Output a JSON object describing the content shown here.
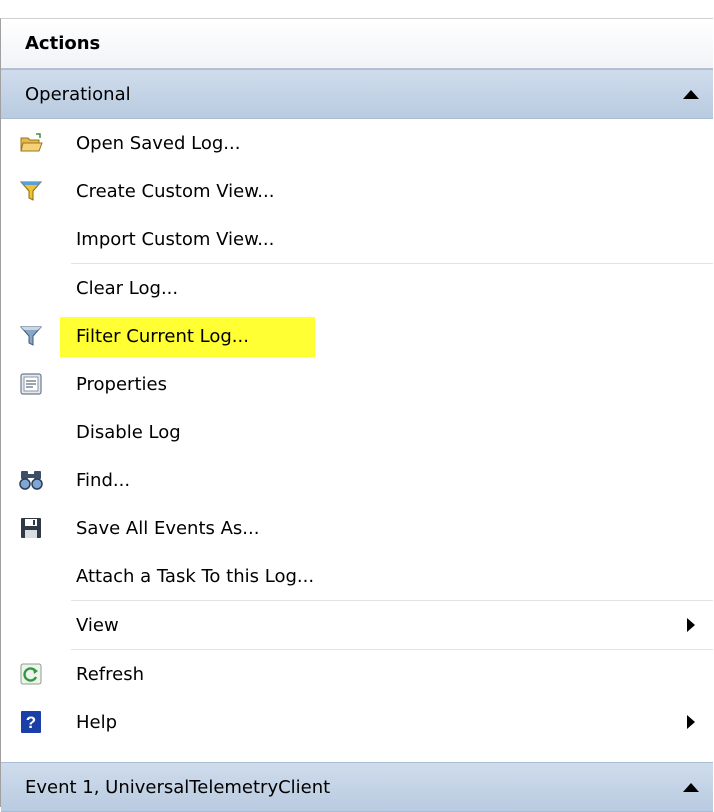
{
  "pane": {
    "title": "Actions"
  },
  "section_operational": {
    "title": "Operational"
  },
  "items": {
    "open_saved_log": "Open Saved Log...",
    "create_custom_view": "Create Custom View...",
    "import_custom_view": "Import Custom View...",
    "clear_log": "Clear Log...",
    "filter_current_log": "Filter Current Log...",
    "properties": "Properties",
    "disable_log": "Disable Log",
    "find": "Find...",
    "save_all_events_as": "Save All Events As...",
    "attach_task": "Attach a Task To this Log...",
    "view": "View",
    "refresh": "Refresh",
    "help": "Help"
  },
  "section_event": {
    "title": "Event 1, UniversalTelemetryClient"
  },
  "colors": {
    "highlight": "#ffff33",
    "section_header": "#c3d3e6",
    "help_blue": "#1a3fa6",
    "refresh_green": "#2e9b3a"
  },
  "icons": {
    "open_saved_log": "folder-icon",
    "create_custom_view": "funnel-color-icon",
    "filter_current_log": "funnel-icon",
    "properties": "properties-sheet-icon",
    "find": "binoculars-icon",
    "save_all_events_as": "floppy-disk-icon",
    "refresh": "refresh-icon",
    "help": "help-icon"
  }
}
